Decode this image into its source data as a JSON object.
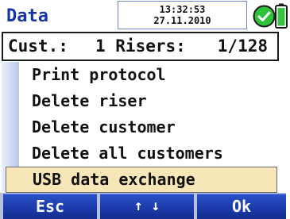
{
  "header": {
    "title": "Data",
    "time": "13:32:53",
    "date": "27.11.2010",
    "status_icon": "check-circle-icon",
    "battery_icon": "battery-icon"
  },
  "info_bar": {
    "cust_label": "Cust.:",
    "risers_text": "1 Risers:",
    "page_count": "1/128"
  },
  "menu": {
    "items": [
      {
        "label": "Print protocol"
      },
      {
        "label": "Delete riser"
      },
      {
        "label": "Delete customer"
      },
      {
        "label": "Delete all customers"
      },
      {
        "label": "USB data exchange",
        "selected": true
      }
    ]
  },
  "softkeys": {
    "esc_label": "Esc",
    "nav_label": "↑ ↓",
    "ok_label": "Ok"
  },
  "colors": {
    "title": "#1733a8",
    "selection": "#f7e6b8",
    "softkey": "#1e3fb1",
    "status_ok": "#2ec23a"
  }
}
